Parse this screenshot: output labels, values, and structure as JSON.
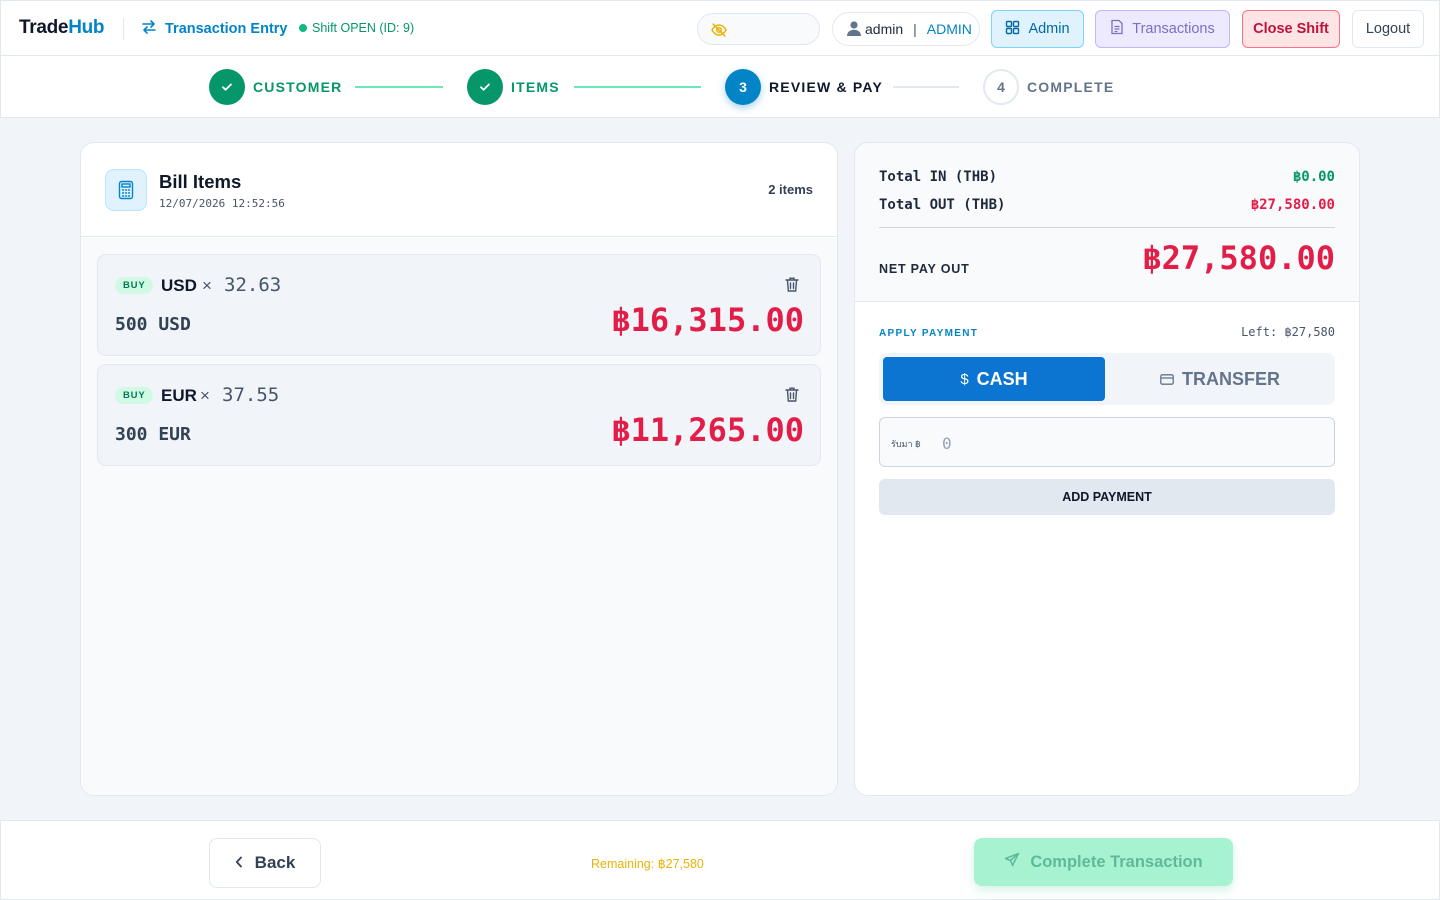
{
  "header": {
    "brand_trade": "Trade",
    "brand_hub": "Hub",
    "mode_label": "Transaction Entry",
    "shift_status": "Shift OPEN (ID: 9)",
    "username": "admin",
    "separator": "|",
    "role": "ADMIN",
    "admin_label": "Admin",
    "transactions_label": "Transactions",
    "close_shift_label": "Close Shift",
    "logout_label": "Logout"
  },
  "stepper": {
    "steps": [
      {
        "number": "1",
        "label": "CUSTOMER",
        "state": "done"
      },
      {
        "number": "2",
        "label": "ITEMS",
        "state": "done"
      },
      {
        "number": "3",
        "label": "REVIEW & PAY",
        "state": "active"
      },
      {
        "number": "4",
        "label": "COMPLETE",
        "state": "todo"
      }
    ]
  },
  "bill": {
    "title": "Bill Items",
    "timestamp": "12/07/2026 12:52:56",
    "count": "2 items",
    "items": [
      {
        "side": "BUY",
        "currency": "USD",
        "times": "×",
        "rate": "32.63",
        "quantity": "500 USD",
        "amount": "฿16,315.00"
      },
      {
        "side": "BUY",
        "currency": "EUR",
        "times": "×",
        "rate": "37.55",
        "quantity": "300 EUR",
        "amount": "฿11,265.00"
      }
    ]
  },
  "summary": {
    "total_in_label": "Total IN (THB)",
    "total_in_value": "฿0.00",
    "total_out_label": "Total OUT (THB)",
    "total_out_value": "฿27,580.00",
    "net_label": "NET PAY OUT",
    "net_value": "฿27,580.00"
  },
  "payment": {
    "apply_label": "APPLY PAYMENT",
    "left_label": "Left: ฿27,580",
    "cash_label": "CASH",
    "transfer_label": "TRANSFER",
    "input_prefix": "รับมา ฿",
    "input_placeholder": "0",
    "add_label": "ADD PAYMENT"
  },
  "footer": {
    "back_label": "Back",
    "remaining": "Remaining: ฿27,580",
    "complete_label": "Complete Transaction"
  },
  "colors": {
    "accent": "#0284c7",
    "success": "#059669",
    "danger": "#e11d48",
    "warning": "#eab308"
  }
}
